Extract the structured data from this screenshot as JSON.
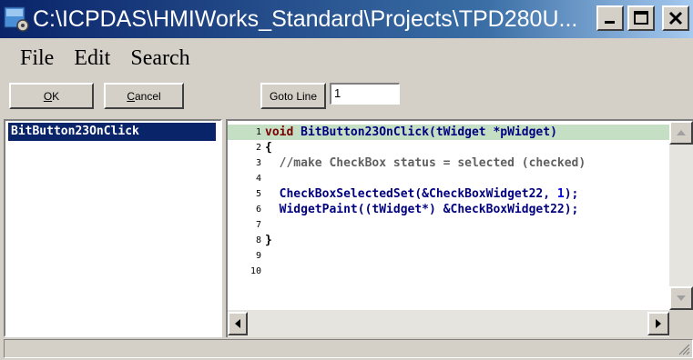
{
  "window": {
    "title": "C:\\ICPDAS\\HMIWorks_Standard\\Projects\\TPD280U..."
  },
  "icons": [
    "app-icon",
    "minimize-icon",
    "maximize-icon",
    "close-icon",
    "scroll-up-icon",
    "scroll-down-icon",
    "scroll-left-icon",
    "scroll-right-icon",
    "resize-grip-icon"
  ],
  "menu": {
    "file": "File",
    "edit": "Edit",
    "search": "Search"
  },
  "toolbar": {
    "ok_label": "OK",
    "cancel_label": "Cancel",
    "goto_label": "Goto Line",
    "goto_value": "1"
  },
  "functions": [
    "BitButton23OnClick"
  ],
  "editor": {
    "line_numbers": [
      "1",
      "2",
      "3",
      "4",
      "5",
      "6",
      "7",
      "8",
      "9",
      "10"
    ],
    "lines": [
      {
        "tokens": [
          {
            "t": "void",
            "c": "kw"
          },
          {
            "t": " BitButton23OnClick(tWidget *pWidget)",
            "c": "id"
          }
        ]
      },
      {
        "tokens": [
          {
            "t": "{",
            "c": "pn"
          }
        ]
      },
      {
        "tokens": [
          {
            "t": "  //make CheckBox status = selected (checked)",
            "c": "cm"
          }
        ]
      },
      {
        "tokens": []
      },
      {
        "tokens": [
          {
            "t": "  CheckBoxSelectedSet(&CheckBoxWidget22, ",
            "c": "id"
          },
          {
            "t": "1",
            "c": "num"
          },
          {
            "t": ");",
            "c": "id"
          }
        ]
      },
      {
        "tokens": [
          {
            "t": "  WidgetPaint((tWidget*) &CheckBoxWidget22);",
            "c": "id"
          }
        ]
      },
      {
        "tokens": []
      },
      {
        "tokens": [
          {
            "t": "}",
            "c": "pn"
          }
        ]
      },
      {
        "tokens": []
      },
      {
        "tokens": []
      }
    ],
    "highlighted_line": 1
  },
  "colors": {
    "title_gradient_start": "#0a246a",
    "title_gradient_end": "#a6caf0",
    "selection": "#0a246a",
    "line_highlight": "#c4dfc4",
    "keyword": "#7a0000",
    "identifier": "#000080",
    "comment": "#606060",
    "number": "#0000ff"
  }
}
